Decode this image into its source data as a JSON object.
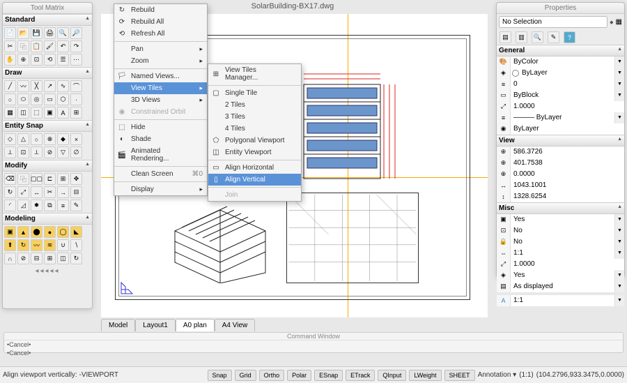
{
  "doc_title": "SolarBuilding-BX17.dwg",
  "tool_matrix": {
    "title": "Tool Matrix",
    "sections": [
      "Standard",
      "Draw",
      "Entity Snap",
      "Modify",
      "Modeling"
    ]
  },
  "menu1": {
    "rebuild": "Rebuild",
    "rebuild_all": "Rebuild All",
    "refresh_all": "Refresh All",
    "pan": "Pan",
    "zoom": "Zoom",
    "named_views": "Named Views...",
    "view_tiles": "View Tiles",
    "views_3d": "3D Views",
    "constrained_orbit": "Constrained Orbit",
    "hide": "Hide",
    "shade": "Shade",
    "anim_render": "Animated Rendering...",
    "clean_screen": "Clean Screen",
    "clean_screen_sc": "⌘0",
    "display": "Display"
  },
  "menu2": {
    "view_tiles_mgr": "View Tiles Manager...",
    "single_tile": "Single Tile",
    "tiles2": "2 Tiles",
    "tiles3": "3 Tiles",
    "tiles4": "4 Tiles",
    "poly_vp": "Polygonal Viewport",
    "entity_vp": "Entity Viewport",
    "align_h": "Align Horizontal",
    "align_v": "Align Vertical",
    "join": "Join"
  },
  "tabs": [
    "Model",
    "Layout1",
    "A0 plan",
    "A4 View"
  ],
  "active_tab": 2,
  "command_window_title": "Command Window",
  "cancel_text": "•Cancel•",
  "status_prompt": "Align viewport vertically: -VIEWPORT",
  "status_buttons": [
    "Snap",
    "Grid",
    "Ortho",
    "Polar",
    "ESnap",
    "ETrack",
    "QInput",
    "LWeight",
    "SHEET"
  ],
  "annotation_label": "Annotation",
  "scale_label": "(1:1)",
  "coords": "(104.2796,933.3475,0.0000)",
  "properties": {
    "title": "Properties",
    "selection": "No Selection",
    "sections": {
      "general": "General",
      "view": "View",
      "misc": "Misc"
    },
    "general": {
      "color": "ByColor",
      "layer": "ByLayer",
      "level": "0",
      "block": "ByBlock",
      "scale": "1.0000",
      "ltype": "——— ByLayer",
      "pstyle": "ByLayer"
    },
    "view": {
      "v1": "586.3726",
      "v2": "401.7538",
      "v3": "0.0000",
      "v4": "1043.1001",
      "v5": "1328.6254"
    },
    "misc": {
      "m1": "Yes",
      "m2": "No",
      "m3": "No",
      "m4": "1:1",
      "m5": "1.0000",
      "m6": "Yes",
      "m7": "As displayed",
      "m8": "1:1"
    }
  }
}
